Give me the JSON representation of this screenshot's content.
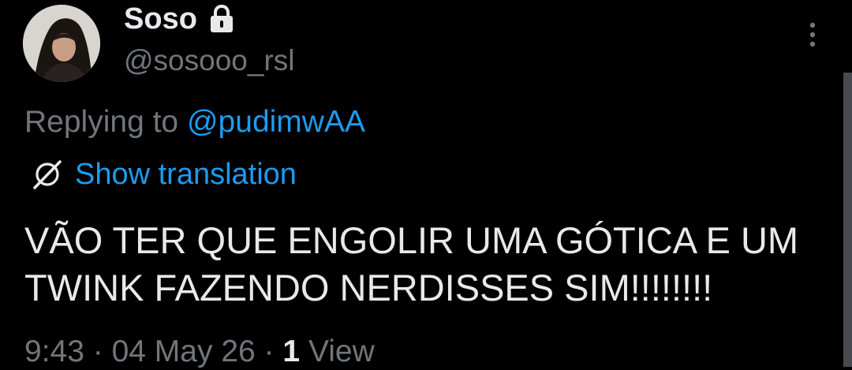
{
  "author": {
    "name": "Soso",
    "handle": "@sosooo_rsl",
    "protected_icon": "lock-icon",
    "avatar_icon": "avatar"
  },
  "menu": {
    "icon": "more-vertical-icon"
  },
  "reply": {
    "prefix": "Replying to",
    "mention": "@pudimwAA"
  },
  "translation": {
    "icon": "globe-icon",
    "label": "Show translation"
  },
  "tweet": {
    "text": "VÃO TER QUE ENGOLIR UMA GÓTICA E UM TWINK FAZENDO NERDISSES SIM!!!!!!!!"
  },
  "meta": {
    "time": "9:43",
    "separator": "·",
    "date": "04 May 26",
    "view_count": "1",
    "view_label": "View"
  },
  "colors": {
    "background": "#000000",
    "text": "#e7e9ea",
    "secondary": "#71767b",
    "accent": "#1d9bf0"
  }
}
